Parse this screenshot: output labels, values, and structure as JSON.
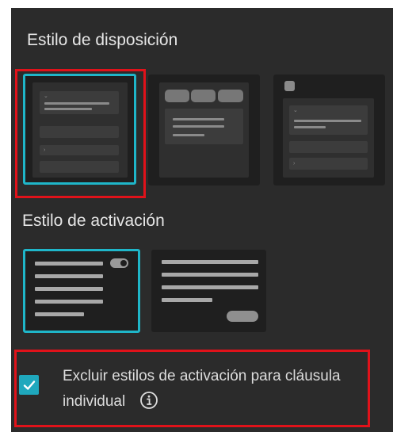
{
  "layout_style": {
    "heading": "Estilo de disposición",
    "options": [
      {
        "name": "layout-option-1",
        "selected": true
      },
      {
        "name": "layout-option-2",
        "selected": false
      },
      {
        "name": "layout-option-3",
        "selected": false
      }
    ]
  },
  "activation_style": {
    "heading": "Estilo de activación",
    "options": [
      {
        "name": "activation-option-toggle",
        "selected": true
      },
      {
        "name": "activation-option-button",
        "selected": false
      }
    ]
  },
  "exclude_option": {
    "label": "Excluir estilos de activación para cláusula individual",
    "checked": true,
    "icon": "info-icon"
  },
  "colors": {
    "panel": "#2b2b2b",
    "accent": "#1fb6c9",
    "highlight": "#e0121a"
  }
}
